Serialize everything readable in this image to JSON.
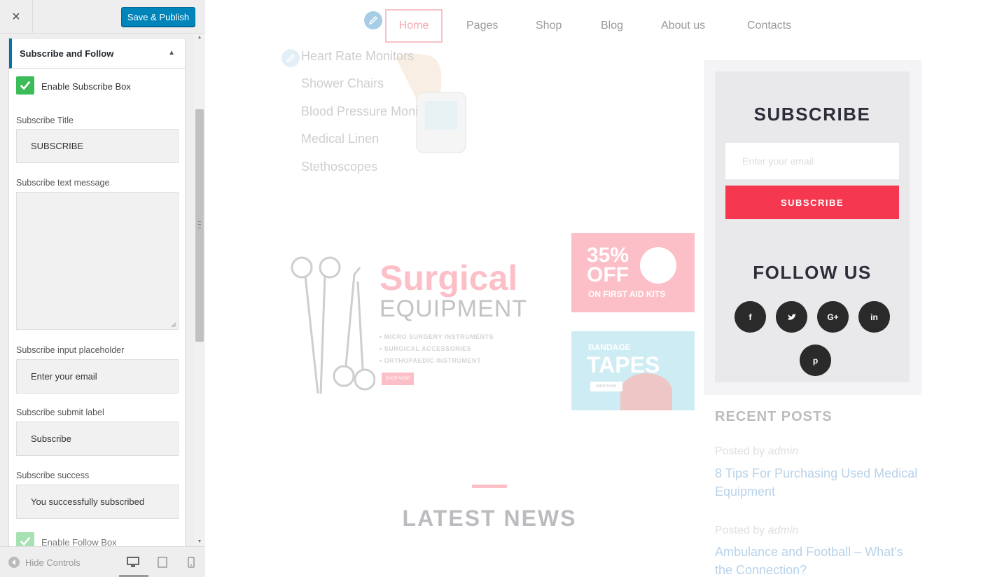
{
  "sidebar": {
    "close_label": "×",
    "save_label": "Save & Publish",
    "section_title": "Subscribe and Follow",
    "enable_subscribe_label": "Enable Subscribe Box",
    "enable_subscribe_checked": true,
    "fields": {
      "title_label": "Subscribe Title",
      "title_value": "SUBSCRIBE",
      "text_label": "Subscribe text message",
      "text_value": "",
      "placeholder_label": "Subscribe input placeholder",
      "placeholder_value": "Enter your email",
      "submit_label": "Subscribe submit label",
      "submit_value": "Subscribe",
      "success_label": "Subscribe success",
      "success_value": "You successfully subscribed"
    },
    "enable_follow_label": "Enable Follow Box",
    "enable_follow_checked": true,
    "footer": {
      "hide_controls": "Hide Controls"
    },
    "accent_color": "#0085ba"
  },
  "preview": {
    "nav": [
      "Home",
      "Pages",
      "Shop",
      "Blog",
      "About us",
      "Contacts"
    ],
    "categories": [
      "Heart Rate Monitors",
      "Shower Chairs",
      "Blood Pressure Moni",
      "Medical Linen",
      "Stethoscopes"
    ],
    "banner": {
      "title": "Surgical",
      "subtitle": "EQUIPMENT",
      "bullets": [
        "MICRO SURGERY INSTRUMENTS",
        "SURGICAL ACCESSORIES",
        "ORTHOPAEDIC INSTRUMENT"
      ],
      "button": "SHOP NOW!"
    },
    "promo_off": {
      "pct": "35%",
      "off": "OFF",
      "sub": "ON FIRST AID KITS"
    },
    "promo_tape": {
      "small": "BANDAGE",
      "big": "TAPES",
      "button": "SHOP NOW!"
    },
    "widget": {
      "subscribe_title": "SUBSCRIBE",
      "input_placeholder": "Enter your email",
      "button": "SUBSCRIBE",
      "follow_title": "FOLLOW US",
      "social": [
        "f",
        "t",
        "G+",
        "in",
        "p"
      ]
    },
    "recent_posts": {
      "title": "RECENT POSTS",
      "posts": [
        {
          "meta": "Posted by",
          "author": "admin",
          "title": "8 Tips For Purchasing Used Medical Equipment"
        },
        {
          "meta": "Posted by",
          "author": "admin",
          "title": "Ambulance and Football – What's the Connection?"
        }
      ]
    },
    "latest_news": "LATEST NEWS",
    "brand_color": "#f5384f"
  }
}
